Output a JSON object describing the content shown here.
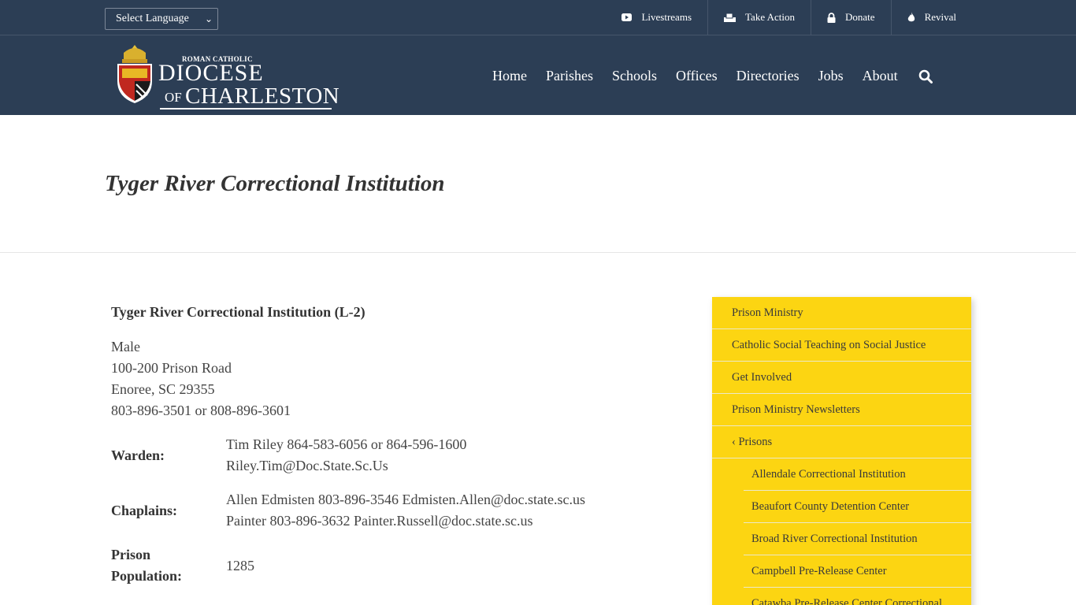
{
  "topbar": {
    "language_select": "Select Language",
    "links": [
      {
        "label": "Livestreams",
        "icon": "youtube-icon"
      },
      {
        "label": "Take Action",
        "icon": "ballot-box-icon"
      },
      {
        "label": "Donate",
        "icon": "lock-icon"
      },
      {
        "label": "Revival",
        "icon": "flame-icon"
      }
    ]
  },
  "header": {
    "logo": {
      "small_text": "ROMAN CATHOLIC",
      "line1": "DIOCESE",
      "of": "OF",
      "line2": "CHARLESTON"
    },
    "nav": [
      "Home",
      "Parishes",
      "Schools",
      "Offices",
      "Directories",
      "Jobs",
      "About"
    ]
  },
  "page": {
    "title": "Tyger River Correctional Institution"
  },
  "content": {
    "heading": "Tyger River Correctional Institution (L-2)",
    "address_lines": [
      "Male",
      "100-200 Prison Road",
      "Enoree, SC 29355",
      "803-896-3501 or 808-896-3601"
    ],
    "warden_label": "Warden:",
    "warden_lines": [
      "Tim Riley 864-583-6056 or 864-596-1600",
      "Riley.Tim@Doc.State.Sc.Us"
    ],
    "chaplains_label": "Chaplains:",
    "chaplains_lines": [
      "Allen Edmisten 803-896-3546 Edmisten.Allen@doc.state.sc.us",
      "Painter 803-896-3632 Painter.Russell@doc.state.sc.us"
    ],
    "population_label_1": "Prison",
    "population_label_2": "Population:",
    "population_value": "1285"
  },
  "sidebar": {
    "items": [
      "Prison Ministry",
      "Catholic Social Teaching on Social Justice",
      "Get Involved",
      "Prison Ministry Newsletters",
      "‹ Prisons"
    ],
    "subitems": [
      "Allendale Correctional Institution",
      "Beaufort County Detention Center",
      "Broad River Correctional Institution",
      "Campbell Pre-Release Center",
      "Catawba Pre-Release Center Correctional"
    ]
  },
  "colors": {
    "header_bg": "#2c3e55",
    "sidebar_bg": "#fcd512"
  }
}
